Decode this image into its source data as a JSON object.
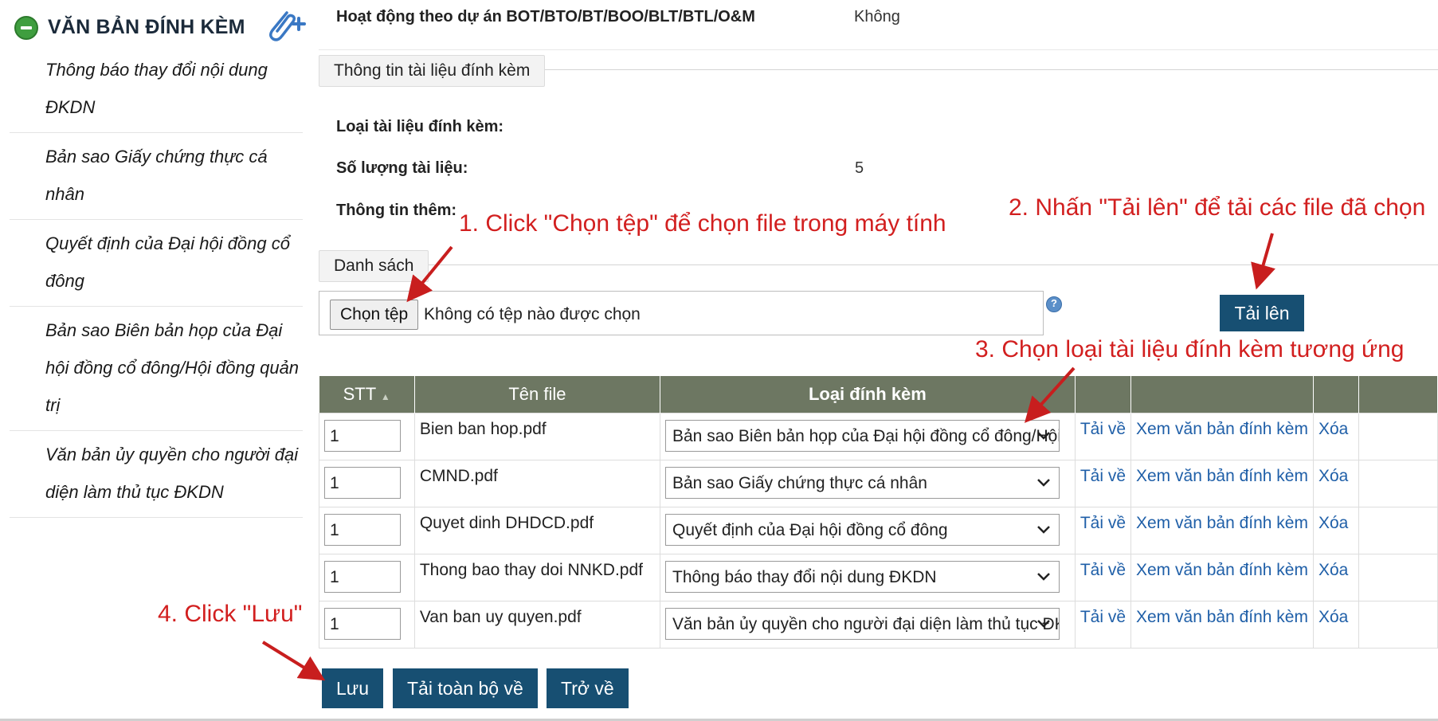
{
  "sidebar": {
    "title": "VĂN BẢN ĐÍNH KÈM",
    "items": [
      {
        "label": "Thông báo thay đổi nội dung ĐKDN"
      },
      {
        "label": "Bản sao Giấy chứng thực cá nhân"
      },
      {
        "label": "Quyết định của Đại hội đồng cổ đông"
      },
      {
        "label": "Bản sao Biên bản họp của Đại hội đồng cổ đông/Hội đồng quản trị"
      },
      {
        "label": "Văn bản ủy quyền cho người đại diện làm thủ tục ĐKDN"
      }
    ]
  },
  "top_row": {
    "label": "Hoạt động theo dự án BOT/BTO/BT/BOO/BLT/BTL/O&M",
    "value": "Không"
  },
  "attachment_info": {
    "legend": "Thông tin tài liệu đính kèm",
    "type_label": "Loại tài liệu đính kèm:",
    "count_label": "Số lượng tài liệu:",
    "count_value": "5",
    "extra_label": "Thông tin thêm:"
  },
  "list_section": {
    "legend": "Danh sách",
    "choose_button": "Chọn tệp",
    "choose_status": "Không có tệp nào được chọn",
    "upload_button": "Tải lên"
  },
  "table": {
    "headers": {
      "stt": "STT",
      "file_name": "Tên file",
      "type": "Loại đính kèm"
    },
    "rows": [
      {
        "stt": "1",
        "file": "Bien ban hop.pdf",
        "type": "Bản sao Biên bản họp của Đại hội đồng cổ đông/Hội đồng q",
        "download": "Tải về",
        "view": "Xem văn bản đính kèm",
        "delete": "Xóa"
      },
      {
        "stt": "1",
        "file": "CMND.pdf",
        "type": "Bản sao Giấy chứng thực cá nhân",
        "download": "Tải về",
        "view": "Xem văn bản đính kèm",
        "delete": "Xóa"
      },
      {
        "stt": "1",
        "file": "Quyet dinh DHDCD.pdf",
        "type": "Quyết định của Đại hội đồng cổ đông",
        "download": "Tải về",
        "view": "Xem văn bản đính kèm",
        "delete": "Xóa"
      },
      {
        "stt": "1",
        "file": "Thong bao thay doi NNKD.pdf",
        "type": "Thông báo thay đổi nội dung ĐKDN",
        "download": "Tải về",
        "view": "Xem văn bản đính kèm",
        "delete": "Xóa"
      },
      {
        "stt": "1",
        "file": "Van ban uy quyen.pdf",
        "type": "Văn bản ủy quyền cho người đại diện làm thủ tục ĐKDN",
        "download": "Tải về",
        "view": "Xem văn bản đính kèm",
        "delete": "Xóa"
      }
    ]
  },
  "footer": {
    "save": "Lưu",
    "download_all": "Tải toàn bộ về",
    "back": "Trở về"
  },
  "annotations": {
    "step1": "1. Click \"Chọn tệp\" để chọn file trong máy tính",
    "step2": "2. Nhấn \"Tải lên\" để tải các file đã chọn",
    "step3": "3. Chọn loại tài liệu đính kèm tương ứng",
    "step4": "4. Click \"Lưu\""
  },
  "colors": {
    "button": "#174f72",
    "header": "#6d7762",
    "link": "#1f5fa8",
    "annotation": "#d21f1f",
    "toggle": "#3f9e3f"
  },
  "icons": {
    "sidebar_toggle": "collapse-circle-icon",
    "add_attachment": "paperclip-plus-icon",
    "help": "help-icon",
    "dropdown": "chevron-down-icon",
    "sort": "sort-up-icon"
  }
}
